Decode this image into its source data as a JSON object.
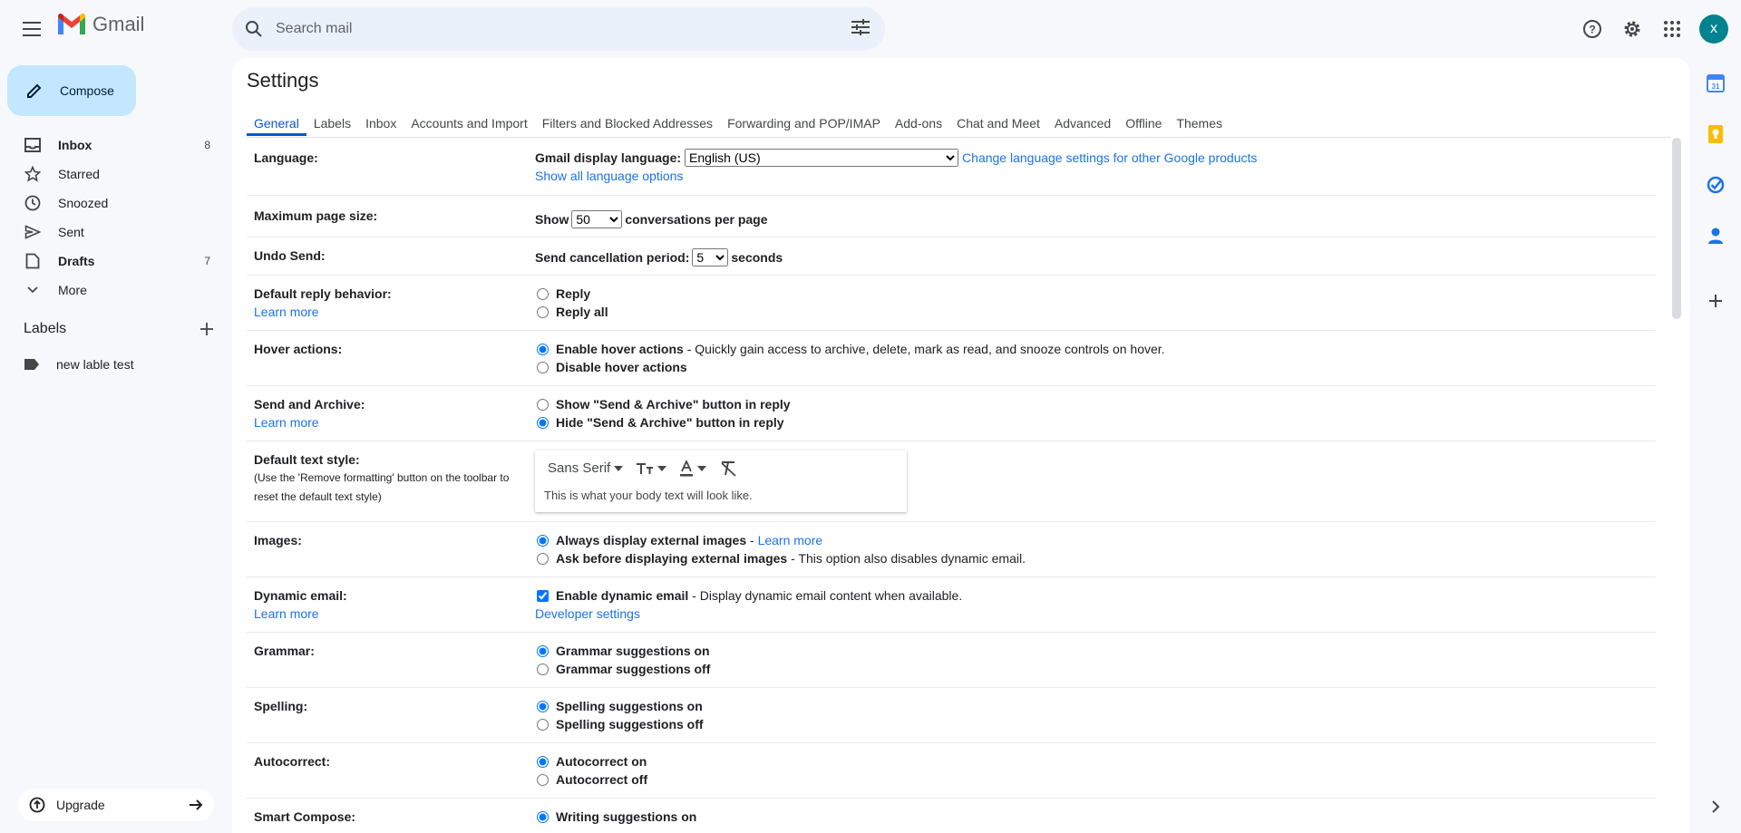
{
  "app": {
    "name": "Gmail"
  },
  "search": {
    "placeholder": "Search mail"
  },
  "user": {
    "initial": "x",
    "avatar_color": "#00838f"
  },
  "sidebar": {
    "compose_label": "Compose",
    "items": [
      {
        "label": "Inbox",
        "count": "8",
        "icon": "inbox-icon",
        "bold": true
      },
      {
        "label": "Starred",
        "count": "",
        "icon": "star-icon",
        "bold": false
      },
      {
        "label": "Snoozed",
        "count": "",
        "icon": "clock-icon",
        "bold": false
      },
      {
        "label": "Sent",
        "count": "",
        "icon": "send-icon",
        "bold": false
      },
      {
        "label": "Drafts",
        "count": "7",
        "icon": "draft-icon",
        "bold": true
      },
      {
        "label": "More",
        "count": "",
        "icon": "chevron-down-icon",
        "bold": false
      }
    ],
    "labels_heading": "Labels",
    "labels": [
      {
        "label": "new lable test"
      }
    ],
    "upgrade_label": "Upgrade"
  },
  "settings": {
    "title": "Settings",
    "tabs": [
      "General",
      "Labels",
      "Inbox",
      "Accounts and Import",
      "Filters and Blocked Addresses",
      "Forwarding and POP/IMAP",
      "Add-ons",
      "Chat and Meet",
      "Advanced",
      "Offline",
      "Themes"
    ],
    "active_tab": "General",
    "learn_more": "Learn more",
    "language": {
      "label": "Language:",
      "display_label": "Gmail display language:",
      "value": "English (US)",
      "change_link": "Change language settings for other Google products",
      "show_all_link": "Show all language options"
    },
    "page_size": {
      "label": "Maximum page size:",
      "prefix": "Show",
      "value": "50",
      "suffix": "conversations per page"
    },
    "undo_send": {
      "label": "Undo Send:",
      "prefix": "Send cancellation period:",
      "value": "5",
      "suffix": "seconds"
    },
    "reply": {
      "label": "Default reply behavior:",
      "options": [
        "Reply",
        "Reply all"
      ]
    },
    "hover": {
      "label": "Hover actions:",
      "enable": "Enable hover actions",
      "enable_desc": " - Quickly gain access to archive, delete, mark as read, and snooze controls on hover.",
      "disable": "Disable hover actions"
    },
    "send_archive": {
      "label": "Send and Archive:",
      "show": "Show \"Send & Archive\" button in reply",
      "hide": "Hide \"Send & Archive\" button in reply"
    },
    "text_style": {
      "label": "Default text style:",
      "note": "(Use the 'Remove formatting' button on the toolbar to reset the default text style)",
      "font": "Sans Serif",
      "preview": "This is what your body text will look like."
    },
    "images": {
      "label": "Images:",
      "always": "Always display external images",
      "ask": "Ask before displaying external images",
      "ask_desc": " - This option also disables dynamic email."
    },
    "dynamic": {
      "label": "Dynamic email:",
      "enable": "Enable dynamic email",
      "enable_desc": " - Display dynamic email content when available.",
      "dev_link": "Developer settings"
    },
    "grammar": {
      "label": "Grammar:",
      "on": "Grammar suggestions on",
      "off": "Grammar suggestions off"
    },
    "spelling": {
      "label": "Spelling:",
      "on": "Spelling suggestions on",
      "off": "Spelling suggestions off"
    },
    "autocorrect": {
      "label": "Autocorrect:",
      "on": "Autocorrect on",
      "off": "Autocorrect off"
    },
    "smart_compose": {
      "label": "Smart Compose:",
      "on": "Writing suggestions on"
    }
  },
  "colors": {
    "accent": "#0b57d0",
    "link": "#1a73e8",
    "compose_bg": "#c2e7ff",
    "page_bg": "#f6f8fc"
  }
}
